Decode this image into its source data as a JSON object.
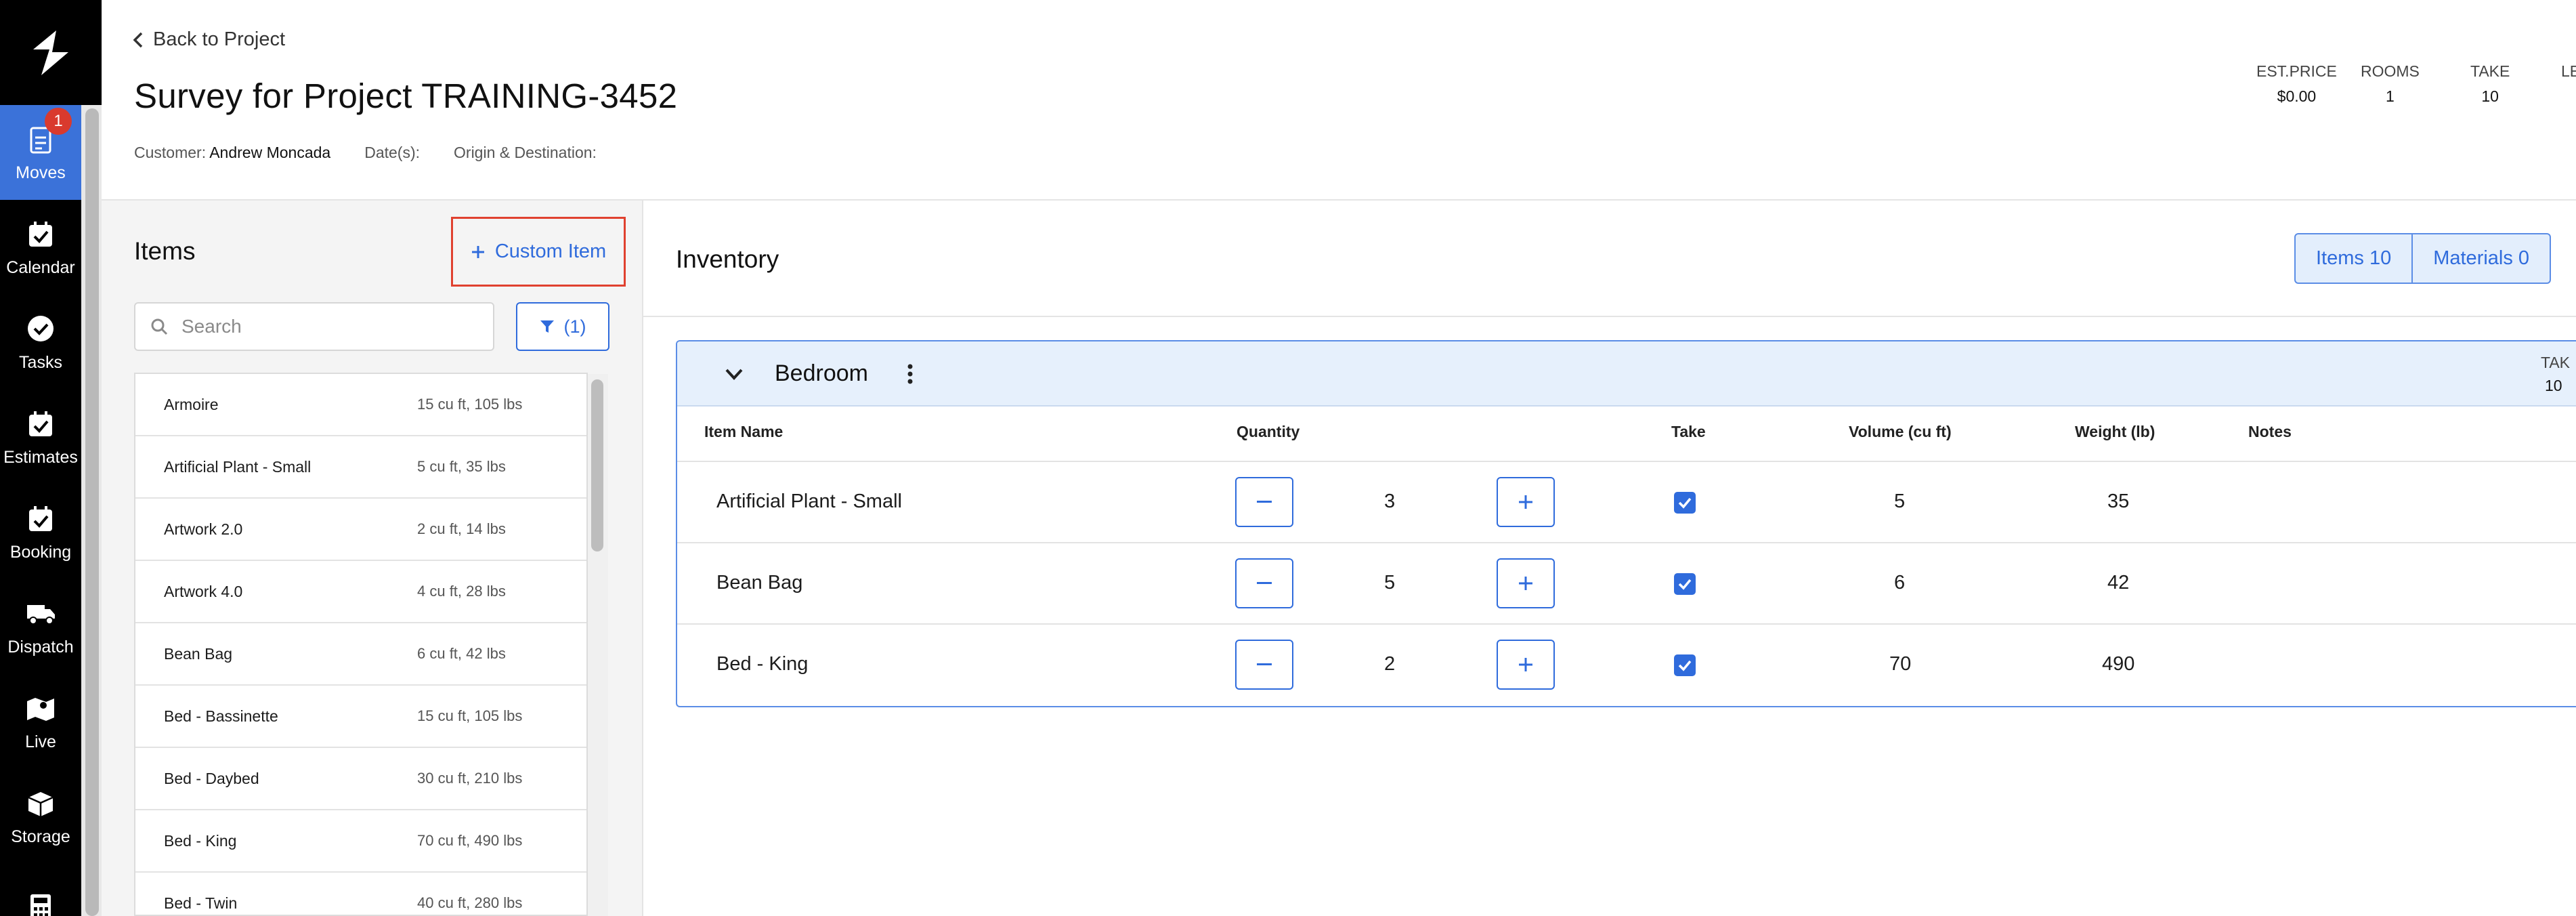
{
  "nav": {
    "items": [
      {
        "label": "Moves",
        "icon": "clipboard-icon",
        "badge": "1",
        "active": true
      },
      {
        "label": "Calendar",
        "icon": "calendar-check-icon"
      },
      {
        "label": "Tasks",
        "icon": "check-circle-icon"
      },
      {
        "label": "Estimates",
        "icon": "calendar-check-icon"
      },
      {
        "label": "Booking",
        "icon": "calendar-check-icon"
      },
      {
        "label": "Dispatch",
        "icon": "truck-icon"
      },
      {
        "label": "Live",
        "icon": "map-marker-icon"
      },
      {
        "label": "Storage",
        "icon": "box-icon"
      },
      {
        "label": "",
        "icon": "calculator-icon"
      }
    ]
  },
  "header": {
    "back_label": "Back to Project",
    "title": "Survey for Project TRAINING-3452",
    "customer_label": "Customer:",
    "customer_value": "Andrew Moncada",
    "dates_label": "Date(s):",
    "origin_label": "Origin & Destination:",
    "stats": [
      {
        "label": "EST.PRICE",
        "value": "$0.00"
      },
      {
        "label": "ROOMS",
        "value": "1"
      },
      {
        "label": "TAKE",
        "value": "10"
      },
      {
        "label": "LE",
        "value": ""
      }
    ]
  },
  "items_panel": {
    "title": "Items",
    "custom_item_label": "Custom Item",
    "search_placeholder": "Search",
    "filter_label": "(1)",
    "list": [
      {
        "name": "Armoire",
        "info": "15 cu ft, 105 lbs"
      },
      {
        "name": "Artificial Plant - Small",
        "info": "5 cu ft, 35 lbs"
      },
      {
        "name": "Artwork 2.0",
        "info": "2 cu ft, 14 lbs"
      },
      {
        "name": "Artwork 4.0",
        "info": "4 cu ft, 28 lbs"
      },
      {
        "name": "Bean Bag",
        "info": "6 cu ft, 42 lbs"
      },
      {
        "name": "Bed - Bassinette",
        "info": "15 cu ft, 105 lbs"
      },
      {
        "name": "Bed - Daybed",
        "info": "30 cu ft, 210 lbs"
      },
      {
        "name": "Bed - King",
        "info": "70 cu ft, 490 lbs"
      },
      {
        "name": "Bed - Twin",
        "info": "40 cu ft, 280 lbs"
      }
    ]
  },
  "inventory": {
    "title": "Inventory",
    "items_tab": "Items 10",
    "materials_tab": "Materials 0",
    "room": {
      "name": "Bedroom",
      "take_label": "TAK",
      "take_value": "10",
      "columns": [
        "Item Name",
        "Quantity",
        "Take",
        "Volume (cu ft)",
        "Weight (lb)",
        "Notes"
      ],
      "rows": [
        {
          "name": "Artificial Plant - Small",
          "qty": "3",
          "take": true,
          "volume": "5",
          "weight": "35"
        },
        {
          "name": "Bean Bag",
          "qty": "5",
          "take": true,
          "volume": "6",
          "weight": "42"
        },
        {
          "name": "Bed - King",
          "qty": "2",
          "take": true,
          "volume": "70",
          "weight": "490"
        }
      ]
    }
  }
}
